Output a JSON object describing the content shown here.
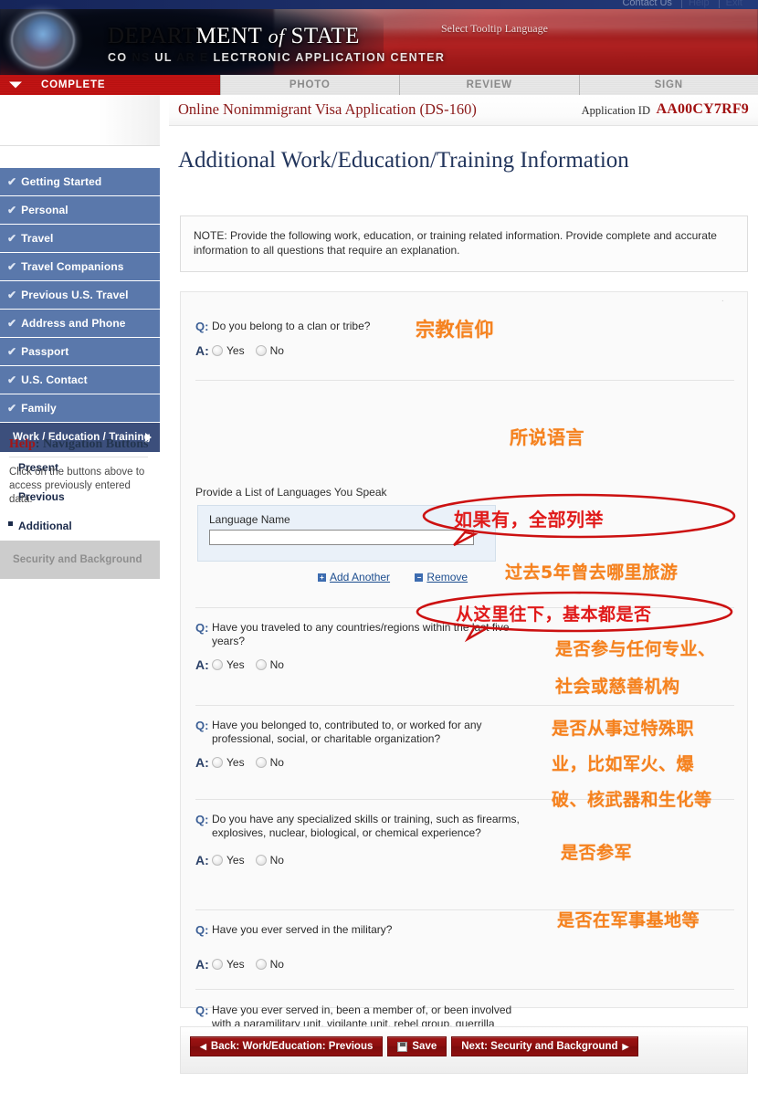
{
  "banner": {
    "dept_line_dim": "DEPART",
    "dept_line_visible": "MENT",
    "dept_of": "of",
    "dept_state": "STATE",
    "subtitle_left": "CO",
    "subtitle_mid": "UL",
    "subtitle_right": "LECTRONIC APPLICATION CENTER",
    "tooltip_language": "Select Tooltip Language",
    "toplinks": [
      "Contact Us",
      "Help",
      "Exit"
    ]
  },
  "tabs": [
    {
      "label": "COMPLETE",
      "active": true
    },
    {
      "label": "PHOTO",
      "active": false
    },
    {
      "label": "REVIEW",
      "active": false
    },
    {
      "label": "SIGN",
      "active": false
    }
  ],
  "sidebar": {
    "items": [
      {
        "label": "Getting Started",
        "state": "done"
      },
      {
        "label": "Personal",
        "state": "done"
      },
      {
        "label": "Travel",
        "state": "done"
      },
      {
        "label": "Travel Companions",
        "state": "done"
      },
      {
        "label": "Previous U.S. Travel",
        "state": "done"
      },
      {
        "label": "Address and Phone",
        "state": "done"
      },
      {
        "label": "Passport",
        "state": "done"
      },
      {
        "label": "U.S. Contact",
        "state": "done"
      },
      {
        "label": "Family",
        "state": "done"
      }
    ],
    "current": {
      "label": "Work / Education / Training"
    },
    "subitems": [
      {
        "label": "Present",
        "selected": false
      },
      {
        "label": "Previous",
        "selected": false
      },
      {
        "label": "Additional",
        "selected": true
      }
    ],
    "disabled": {
      "label": "Security and Background"
    },
    "help": {
      "title_prefix": "Help",
      "title_suffix": ": Navigation Buttons",
      "body": "Click on the buttons above to access previously entered data."
    }
  },
  "header": {
    "app_title": "Online Nonimmigrant Visa Application (DS-160)",
    "app_id_label": "Application ID",
    "app_id_value": "AA00CY7RF9",
    "page_title": "Additional Work/Education/Training Information"
  },
  "note": "NOTE: Provide the following work, education, or training related information. Provide complete and accurate information to all questions that require an explanation.",
  "form": {
    "q_label": "Q:",
    "a_label": "A:",
    "yes_label": "Yes",
    "no_label": "No",
    "questions": [
      {
        "text": "Do you belong to a clan or tribe?"
      },
      {
        "text": "Have you traveled to any countries/regions within the last five years?"
      },
      {
        "text": "Have you belonged to, contributed to, or worked for any professional, social, or charitable organization?"
      },
      {
        "text": "Do you have any specialized skills or training, such as firearms, explosives, nuclear, biological, or chemical experience?"
      },
      {
        "text": "Have you ever served in the military?"
      },
      {
        "text": "Have you ever served in, been a member of, or been involved with a paramilitary unit, vigilante unit, rebel group, guerrilla group, or insurgent organization?"
      }
    ],
    "languages": {
      "section_label": "Provide a List of Languages You Speak",
      "field_label": "Language Name",
      "field_value": "",
      "field_placeholder": "",
      "add_another": "Add Another",
      "remove": "Remove"
    }
  },
  "buttons": {
    "back": "Back: Work/Education: Previous",
    "save": "Save",
    "next": "Next: Security and Background"
  },
  "annotations": [
    {
      "text": "宗教信仰",
      "color": "#f5821f"
    },
    {
      "text": "所说语言",
      "color": "#f5821f"
    },
    {
      "text": "如果有，全部列举",
      "color": "#e01a1a"
    },
    {
      "text": "过去5年曾去哪里旅游",
      "color": "#f5821f"
    },
    {
      "text": "从这里往下，基本都是否",
      "color": "#e01a1a"
    },
    {
      "text": "是否参与任何专业、",
      "color": "#f5821f"
    },
    {
      "text": "社会或慈善机构",
      "color": "#f5821f"
    },
    {
      "text": "是否从事过特殊职",
      "color": "#f5821f"
    },
    {
      "text": "业，比如军火、爆",
      "color": "#f5821f"
    },
    {
      "text": "破、核武器和生化等",
      "color": "#f5821f"
    },
    {
      "text": "是否参军",
      "color": "#f5821f"
    },
    {
      "text": "是否在军事基地等",
      "color": "#f5821f"
    }
  ]
}
